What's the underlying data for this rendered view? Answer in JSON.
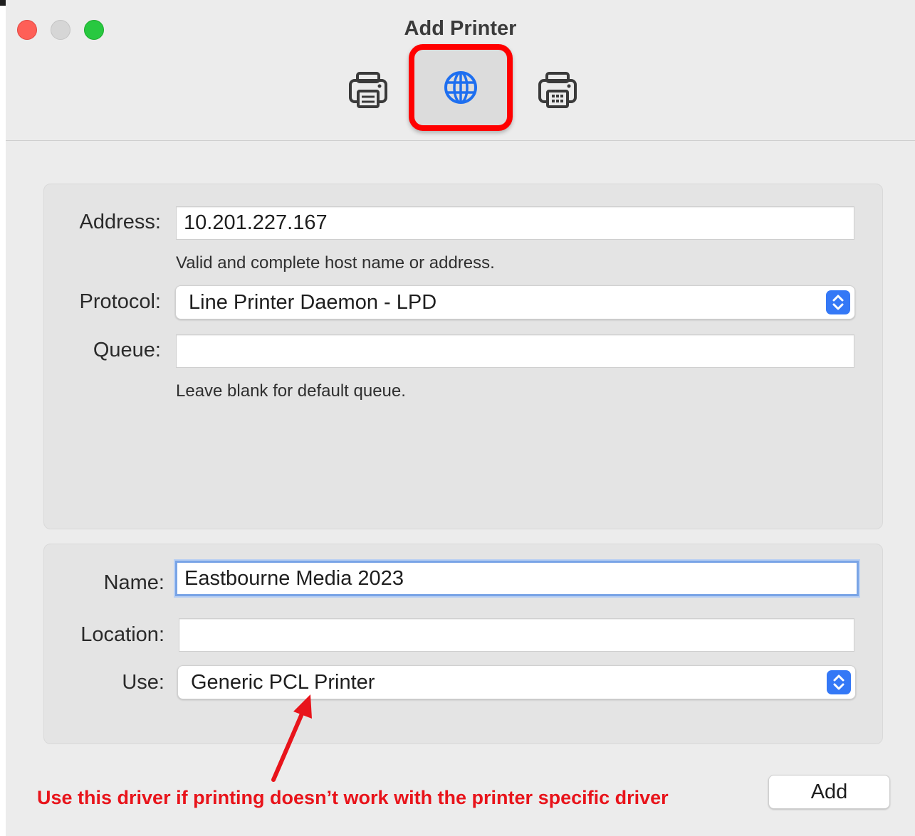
{
  "window": {
    "title": "Add Printer"
  },
  "toolbar": {
    "items": [
      {
        "name": "default",
        "icon": "printer-icon"
      },
      {
        "name": "ip",
        "icon": "globe-icon",
        "selected": true
      },
      {
        "name": "windows",
        "icon": "windows-printer-icon"
      }
    ]
  },
  "form": {
    "address_label": "Address:",
    "address_value": "10.201.227.167",
    "address_hint": "Valid and complete host name or address.",
    "protocol_label": "Protocol:",
    "protocol_value": "Line Printer Daemon - LPD",
    "queue_label": "Queue:",
    "queue_value": "",
    "queue_hint": "Leave blank for default queue.",
    "name_label": "Name:",
    "name_value": "Eastbourne Media 2023",
    "location_label": "Location:",
    "location_value": "",
    "use_label": "Use:",
    "use_value": "Generic PCL Printer"
  },
  "add_button": "Add",
  "annotation": "Use this driver if printing doesn’t work with the printer specific driver",
  "colors": {
    "highlight": "#ff0000",
    "annotation": "#e8141b",
    "accent": "#3478f6"
  }
}
